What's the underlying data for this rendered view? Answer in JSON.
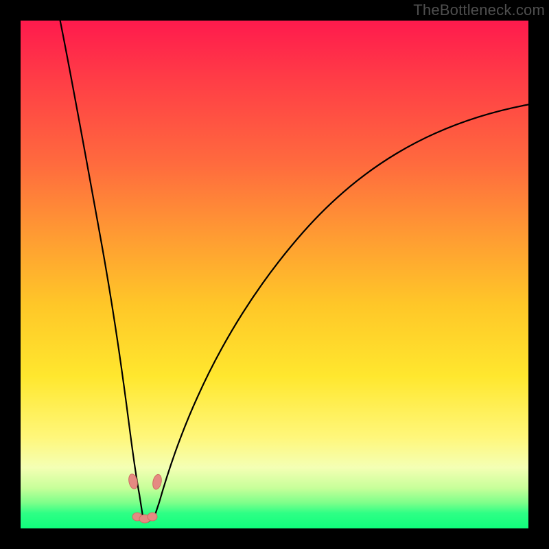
{
  "watermark": "TheBottleneck.com",
  "colors": {
    "frame_bg": "#000000",
    "curve_stroke": "#000000",
    "marker_fill": "#e58a82",
    "marker_stroke": "#cf6d63",
    "gradient_top": "#ff1a4d",
    "gradient_bottom": "#10ff7c"
  },
  "chart_data": {
    "type": "line",
    "title": "",
    "xlabel": "",
    "ylabel": "",
    "xlim": [
      0,
      100
    ],
    "ylim": [
      0,
      100
    ],
    "grid": false,
    "legend": false,
    "series": [
      {
        "name": "bottleneck-curve",
        "x": [
          5,
          8,
          10,
          12,
          14,
          16,
          18,
          20,
          21,
          22,
          23,
          24,
          25,
          26,
          27,
          28,
          30,
          33,
          36,
          40,
          45,
          50,
          56,
          63,
          71,
          80,
          90,
          100
        ],
        "y": [
          100,
          90,
          80,
          70,
          60,
          48,
          36,
          22,
          14,
          8,
          3,
          1,
          1,
          2,
          5,
          9,
          17,
          28,
          37,
          46,
          55,
          62,
          68,
          74,
          79,
          82,
          84,
          84
        ]
      }
    ],
    "markers": [
      {
        "name": "trough-left",
        "x": 22.0,
        "y": 8.5
      },
      {
        "name": "trough-right",
        "x": 26.6,
        "y": 8.5
      },
      {
        "name": "valley-bottom-a",
        "x": 22.8,
        "y": 2.2
      },
      {
        "name": "valley-bottom-b",
        "x": 24.2,
        "y": 1.8
      },
      {
        "name": "valley-bottom-c",
        "x": 25.8,
        "y": 2.2
      }
    ],
    "annotations": []
  }
}
